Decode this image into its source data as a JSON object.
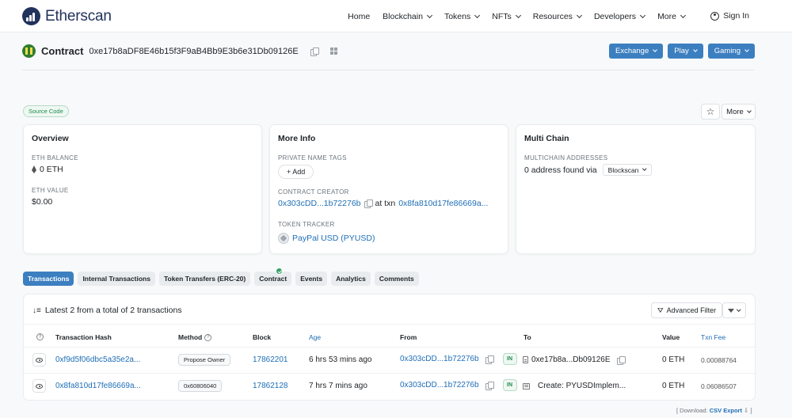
{
  "brand": {
    "name": "Etherscan"
  },
  "nav": {
    "items": [
      "Home",
      "Blockchain",
      "Tokens",
      "NFTs",
      "Resources",
      "Developers",
      "More"
    ],
    "signin": "Sign In"
  },
  "contract": {
    "label": "Contract",
    "address": "0xe17b8aDF8E46b15f3F9aB4Bb9E3b6e31Db09126E"
  },
  "top_buttons": [
    "Exchange",
    "Play",
    "Gaming"
  ],
  "source_badge": "Source Code",
  "more_label": "More",
  "overview": {
    "title": "Overview",
    "eth_balance_label": "ETH BALANCE",
    "eth_balance": "0 ETH",
    "eth_value_label": "ETH VALUE",
    "eth_value": "$0.00"
  },
  "more_info": {
    "title": "More Info",
    "private_tags_label": "PRIVATE NAME TAGS",
    "add_label": "+ Add",
    "creator_label": "CONTRACT CREATOR",
    "creator_addr": "0x303cDD...1b72276b",
    "at_txn": "at txn",
    "creator_txn": "0x8fa810d17fe86669a...",
    "token_tracker_label": "TOKEN TRACKER",
    "token_name": "PayPal USD (PYUSD)"
  },
  "multi_chain": {
    "title": "Multi Chain",
    "addresses_label": "MULTICHAIN ADDRESSES",
    "found_text": "0 address found via",
    "blockscan": "Blockscan"
  },
  "tabs": [
    "Transactions",
    "Internal Transactions",
    "Token Transfers (ERC-20)",
    "Contract",
    "Events",
    "Analytics",
    "Comments"
  ],
  "table": {
    "summary": "Latest 2 from a total of 2 transactions",
    "advanced_filter": "Advanced Filter",
    "headers": {
      "hash": "Transaction Hash",
      "method": "Method",
      "block": "Block",
      "age": "Age",
      "from": "From",
      "to": "To",
      "value": "Value",
      "fee": "Txn Fee"
    },
    "rows": [
      {
        "hash": "0xf9d5f06dbc5a35e2a...",
        "method": "Propose Owner",
        "block": "17862201",
        "age": "6 hrs 53 mins ago",
        "from": "0x303cDD...1b72276b",
        "direction": "IN",
        "to": "0xe17b8a...Db09126E",
        "value": "0 ETH",
        "fee": "0.00088764"
      },
      {
        "hash": "0x8fa810d17fe86669a...",
        "method": "0x60806040",
        "block": "17862128",
        "age": "7 hrs 7 mins ago",
        "from": "0x303cDD...1b72276b",
        "direction": "IN",
        "to": "Create: PYUSDImplem...",
        "value": "0 ETH",
        "fee": "0.06086507"
      }
    ]
  },
  "download": {
    "prefix": "[ Download:",
    "link": "CSV Export",
    "suffix": "]"
  },
  "colors": {
    "accent": "#3c7fc0",
    "link": "#1e6eb7",
    "brand": "#21325b",
    "success": "#1f8a4c"
  }
}
